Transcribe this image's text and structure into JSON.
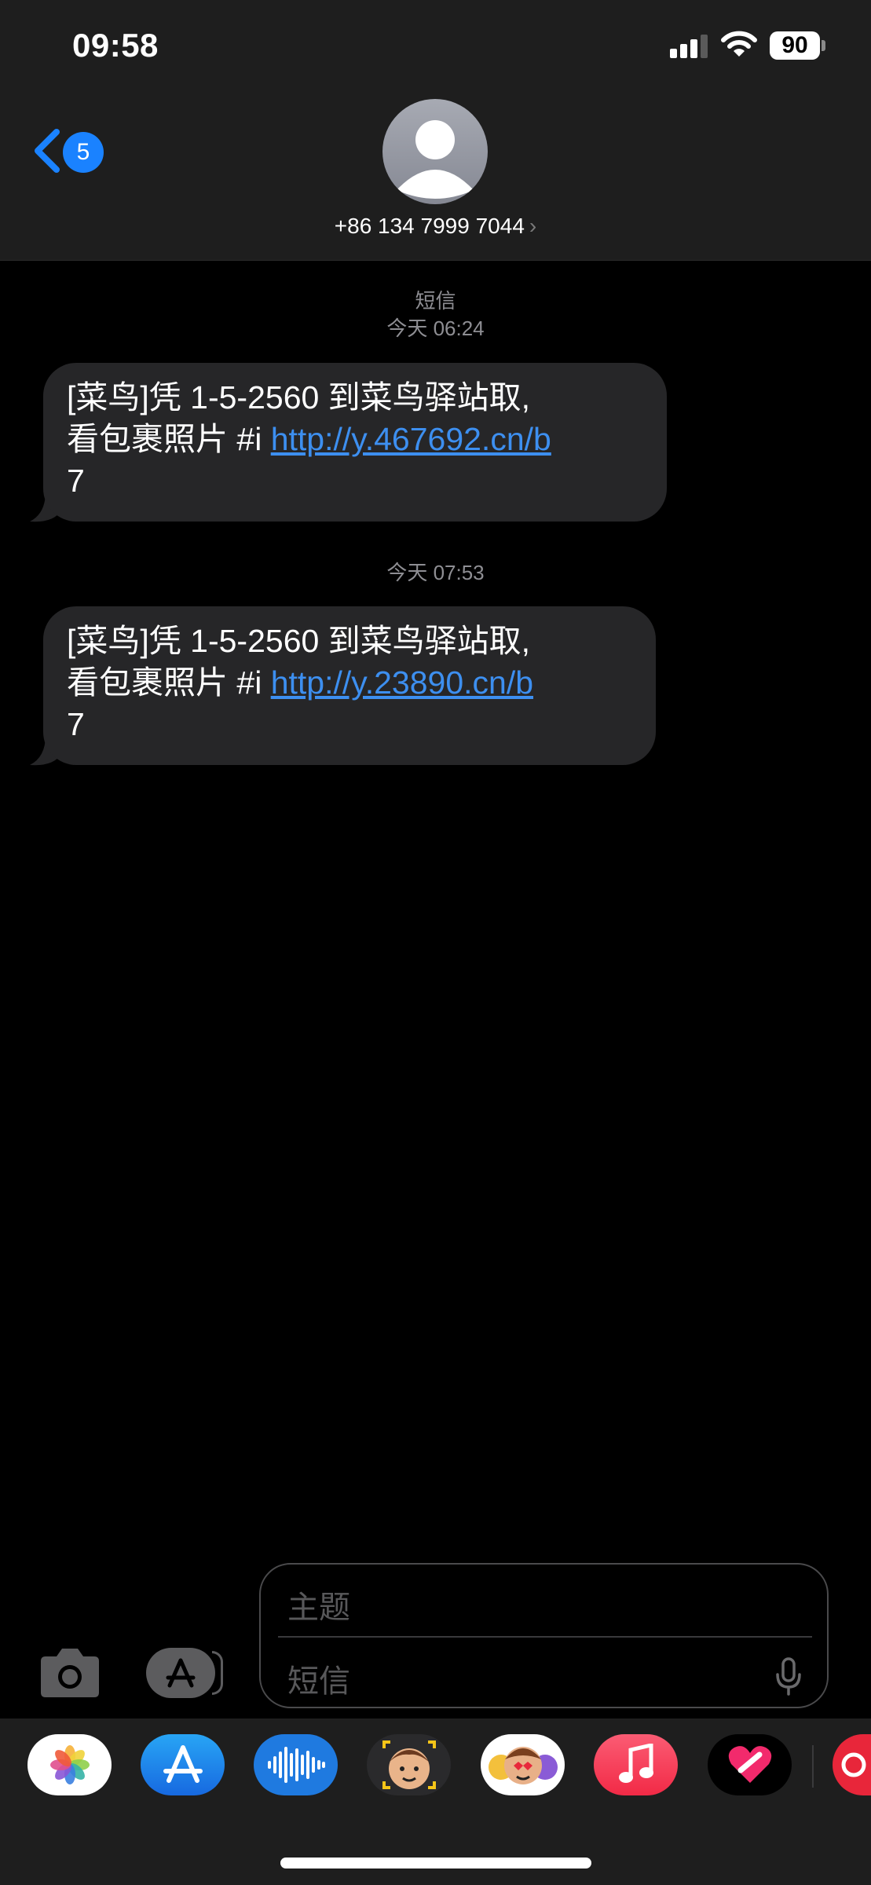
{
  "status_bar": {
    "time": "09:58",
    "battery": "90"
  },
  "nav": {
    "back_badge": "5",
    "contact_number": "+86 134 7999 7044",
    "contact_chevron": "›"
  },
  "conversation": {
    "service_label": "短信",
    "messages": [
      {
        "timestamp": "今天 06:24",
        "text_line1": "[菜鸟]凭 1-5-2560 到菜鸟驿站取,",
        "text_line2_prefix": "看包裹照片 #i  ",
        "link": "http://y.467692.cn/b",
        "text_line3": "7"
      },
      {
        "timestamp": "今天 07:53",
        "text_line1": "[菜鸟]凭 1-5-2560 到菜鸟驿站取,",
        "text_line2_prefix": "看包裹照片 #i  ",
        "link": "http://y.23890.cn/b",
        "text_line3": "7"
      }
    ]
  },
  "compose": {
    "subject_placeholder": "主题",
    "message_placeholder": "短信"
  },
  "app_drawer": {
    "apps": [
      "photos-icon",
      "app-store-icon",
      "audio-message-icon",
      "memoji-stickers-icon",
      "animoji-icon",
      "music-icon",
      "fitness-heart-icon",
      "partial-app-icon"
    ]
  },
  "colors": {
    "accent": "#1a82ff",
    "link": "#3d8ff0",
    "bubble": "#262628",
    "header": "#1e1e1e"
  }
}
